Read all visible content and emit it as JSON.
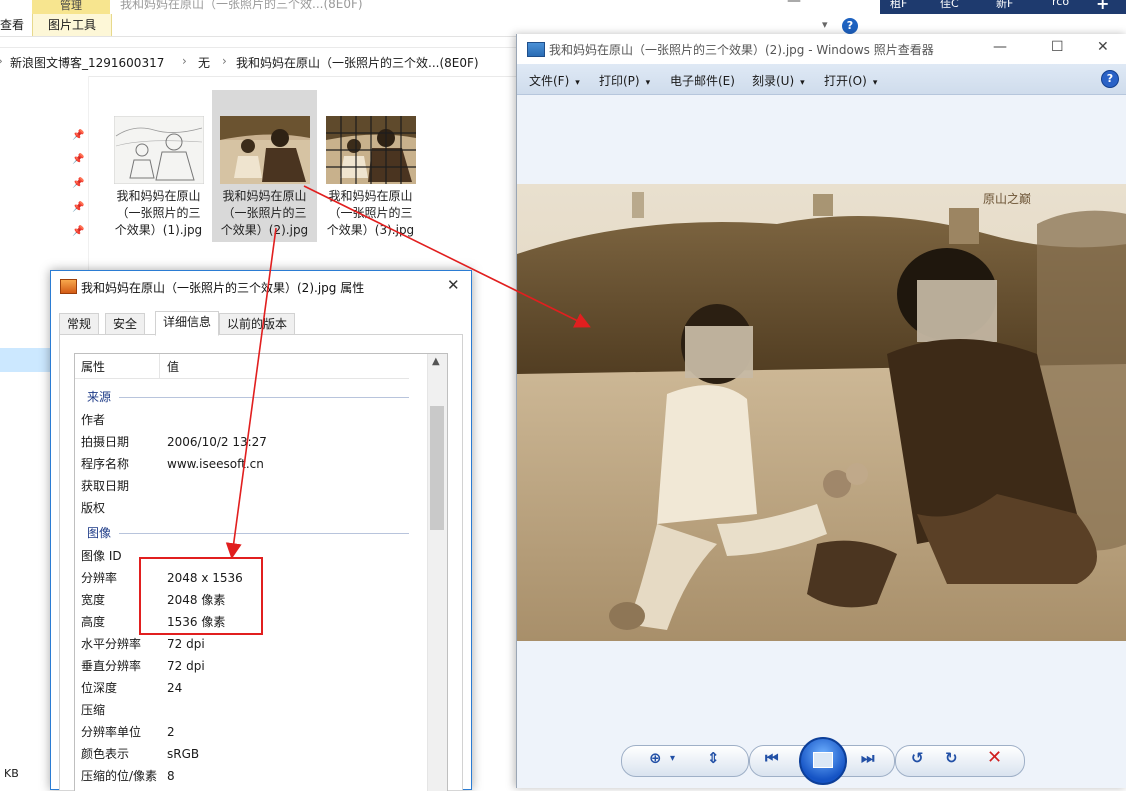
{
  "explorer": {
    "ribbon": {
      "context_tab_group": "管理",
      "context_tab": "图片工具",
      "view_tab": "查看",
      "faded_title": "我和妈妈在原山（一张照片的三个效...(8E0F)"
    },
    "address": [
      {
        "label": "新浪图文博客_1291600317"
      },
      {
        "label": "无"
      },
      {
        "label": "我和妈妈在原山（一张照片的三个效...(8E0F)"
      }
    ],
    "address_separator": "›",
    "files": [
      {
        "name": "我和妈妈在原山（一张照片的三个效果）(1).jpg",
        "line1": "我和妈妈在原山",
        "line2": "（一张照片的三",
        "line3": "个效果）(1).jpg",
        "style": "sketch"
      },
      {
        "name": "我和妈妈在原山（一张照片的三个效果）(2).jpg",
        "line1": "我和妈妈在原山",
        "line2": "（一张照片的三",
        "line3": "个效果）(2).jpg",
        "style": "sepia",
        "selected": true
      },
      {
        "name": "我和妈妈在原山（一张照片的三个效果）(3).jpg",
        "line1": "我和妈妈在原山",
        "line2": "（一张照片的三",
        "line3": "个效果）(3).jpg",
        "style": "grid"
      }
    ],
    "status_size_unit": "KB"
  },
  "taskbar": {
    "items": [
      {
        "label": "租F"
      },
      {
        "label": "佳C"
      },
      {
        "label": "新F"
      },
      {
        "label": "rco"
      }
    ],
    "plus": "+"
  },
  "viewer": {
    "title": "我和妈妈在原山（一张照片的三个效果）(2).jpg - Windows 照片查看器",
    "menu": [
      {
        "label": "文件(F)",
        "has_caret": true
      },
      {
        "label": "打印(P)",
        "has_caret": true
      },
      {
        "label": "电子邮件(E)",
        "has_caret": false
      },
      {
        "label": "刻录(U)",
        "has_caret": true
      },
      {
        "label": "打开(O)",
        "has_caret": true
      }
    ],
    "help_glyph": "?",
    "photo_watermark": "原山之巅",
    "window_controls": {
      "minimize": "—",
      "maximize": "☐",
      "close": "✕"
    },
    "caret": "▾"
  },
  "properties": {
    "title": "我和妈妈在原山（一张照片的三个效果）(2).jpg 属性",
    "tabs": [
      {
        "label": "常规"
      },
      {
        "label": "安全"
      },
      {
        "label": "详细信息",
        "active": true
      },
      {
        "label": "以前的版本"
      }
    ],
    "columns": {
      "property": "属性",
      "value": "值"
    },
    "sections": {
      "origin": {
        "title": "来源",
        "rows": [
          {
            "k": "作者",
            "v": ""
          },
          {
            "k": "拍摄日期",
            "v": "2006/10/2 13:27"
          },
          {
            "k": "程序名称",
            "v": "www.iseesoft.cn"
          },
          {
            "k": "获取日期",
            "v": ""
          },
          {
            "k": "版权",
            "v": ""
          }
        ]
      },
      "image": {
        "title": "图像",
        "rows": [
          {
            "k": "图像 ID",
            "v": ""
          },
          {
            "k": "分辨率",
            "v": "2048 x 1536"
          },
          {
            "k": "宽度",
            "v": "2048 像素"
          },
          {
            "k": "高度",
            "v": "1536 像素"
          },
          {
            "k": "水平分辨率",
            "v": "72 dpi"
          },
          {
            "k": "垂直分辨率",
            "v": "72 dpi"
          },
          {
            "k": "位深度",
            "v": "24"
          },
          {
            "k": "压缩",
            "v": ""
          },
          {
            "k": "分辨率单位",
            "v": "2"
          },
          {
            "k": "颜色表示",
            "v": "sRGB"
          },
          {
            "k": "压缩的位/像素",
            "v": "8"
          }
        ]
      }
    },
    "close_glyph": "✕",
    "scroll_up_glyph": "▲"
  },
  "colors": {
    "annotation_red": "#e11f1f",
    "selection_blue": "#cce8ff",
    "dialog_border": "#2b7cd3",
    "section_title": "#1f3c88"
  }
}
